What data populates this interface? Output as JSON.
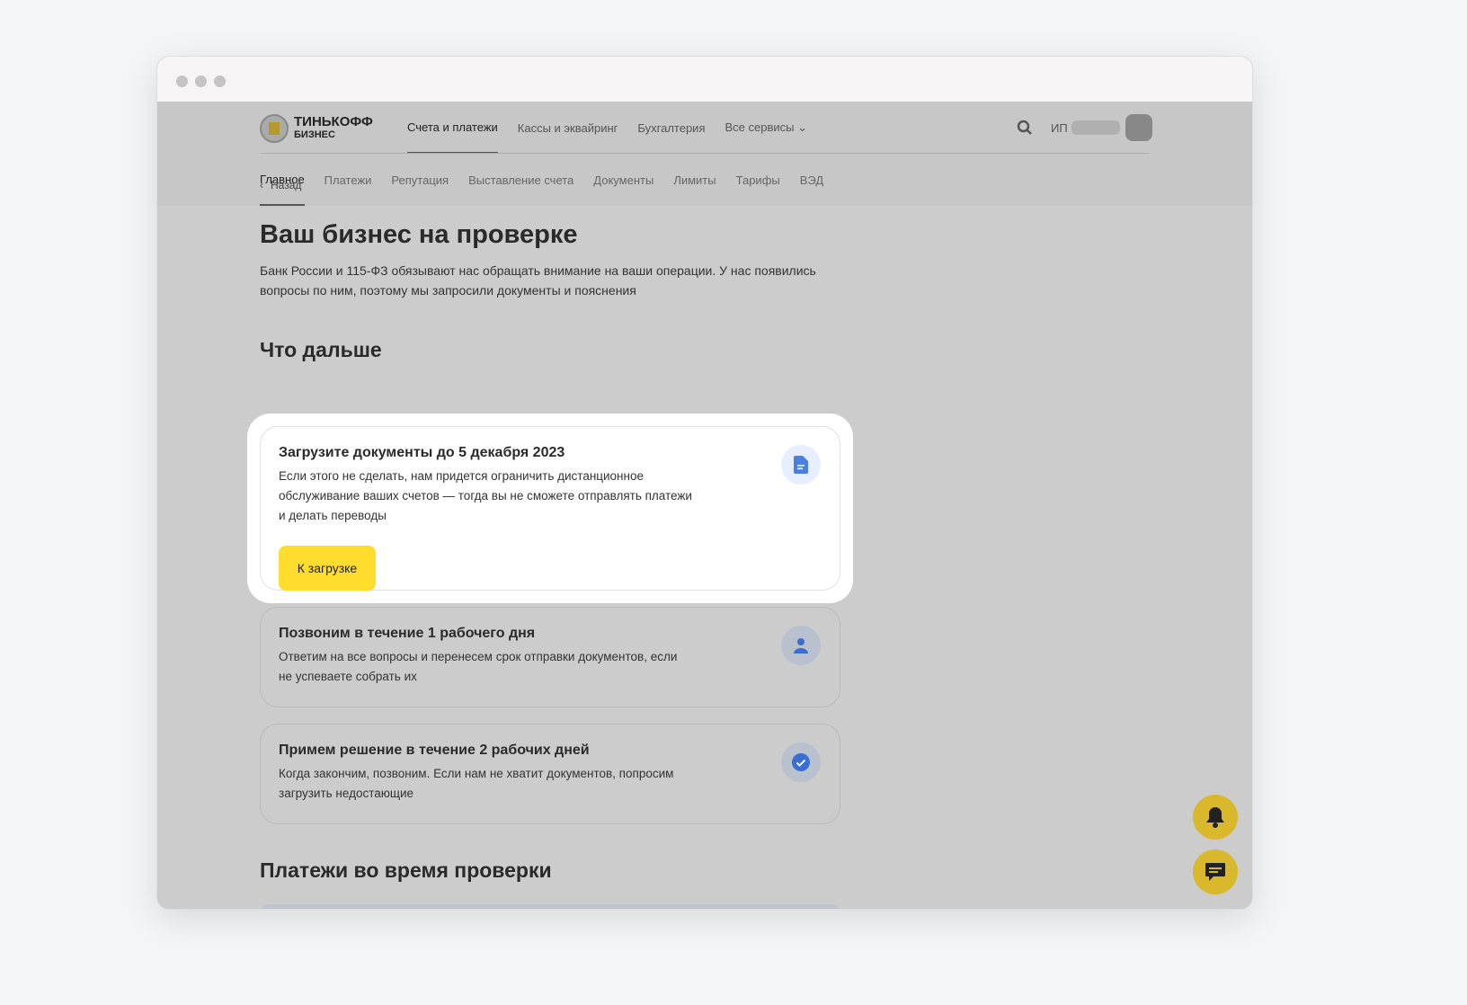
{
  "brand": {
    "name": "ТИНЬКОФФ",
    "sub": "БИЗНЕС"
  },
  "topnav": [
    "Счета и платежи",
    "Кассы и эквайринг",
    "Бухгалтерия",
    "Все сервисы"
  ],
  "user": {
    "prefix": "ИП"
  },
  "subnav": [
    "Главное",
    "Платежи",
    "Репутация",
    "Выставление счета",
    "Документы",
    "Лимиты",
    "Тарифы",
    "ВЭД"
  ],
  "back": "Назад",
  "title": "Ваш бизнес на проверке",
  "lead": "Банк России и 115-ФЗ обязывают нас обращать внимание на ваши операции. У нас появились вопросы по ним, поэтому мы запросили документы и пояснения",
  "next_heading": "Что дальше",
  "steps": [
    {
      "title": "Загрузите документы до 5 декабря 2023",
      "text": "Если этого не сделать, нам придется ограничить дистанционное обслуживание ваших счетов — тогда вы не сможете отправлять платежи и делать переводы",
      "button": "К загрузке",
      "icon": "document-icon"
    },
    {
      "title": "Позвоним в течение 1 рабочего дня",
      "text": "Ответим на все вопросы и перенесем срок отправки документов, если не успеваете собрать их",
      "icon": "person-icon"
    },
    {
      "title": "Примем решение в течение 2 рабочих дней",
      "text": "Когда закончим, позвоним. Если нам не хватит документов, попросим загрузить недостающие",
      "icon": "check-icon"
    }
  ],
  "payments_heading": "Платежи во время проверки",
  "colors": {
    "accent": "#ffdd2d",
    "icon_blue": "#4a7fe0"
  }
}
